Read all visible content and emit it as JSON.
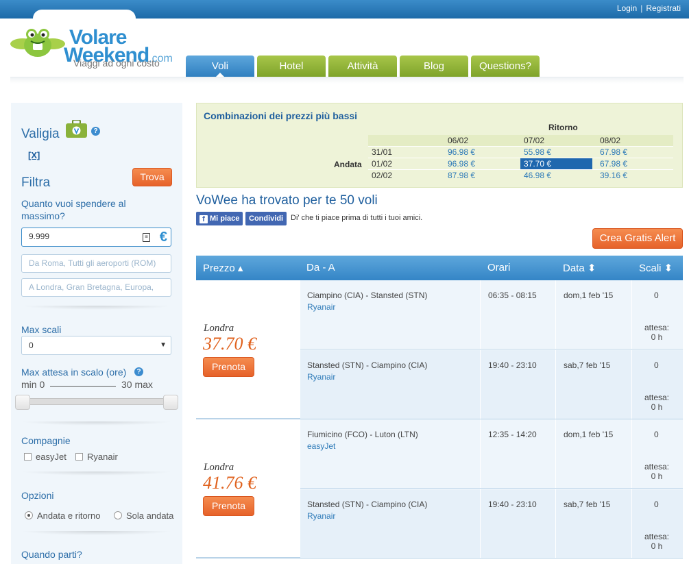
{
  "header": {
    "login": "Login",
    "separator": "|",
    "register": "Registrati"
  },
  "logo": {
    "name_line1": "Volare",
    "name_line2": "Weekend",
    "domain": ".com",
    "tagline": "Viaggi ad ogni costo"
  },
  "nav": {
    "tabs": [
      {
        "label": "Voli",
        "active": true
      },
      {
        "label": "Hotel",
        "active": false
      },
      {
        "label": "Attività",
        "active": false
      },
      {
        "label": "Blog",
        "active": false
      },
      {
        "label": "Questions?",
        "active": false
      }
    ]
  },
  "sidebar": {
    "valigia_title": "Valigia",
    "clear_link": "[X]",
    "filter_title": "Filtra",
    "find_button": "Trova",
    "budget_label": "Quanto vuoi spendere al massimo?",
    "budget_value": "9.999",
    "currency_symbol": "€",
    "from_placeholder": "Da  Roma, Tutti gli aeroporti (ROM)",
    "to_placeholder": "A    Londra, Gran Bretagna, Europa,",
    "max_stops_label": "Max scali",
    "max_stops_value": "0",
    "max_wait_label": "Max attesa in scalo (ore)",
    "min_label": "min 0",
    "max_label": "30 max",
    "airlines_label": "Compagnie",
    "airlines": [
      "easyJet",
      "Ryanair"
    ],
    "options_label": "Opzioni",
    "options": [
      {
        "label": "Andata e ritorno",
        "selected": true
      },
      {
        "label": "Sola andata",
        "selected": false
      }
    ],
    "when_label": "Quando parti?"
  },
  "matrix": {
    "title": "Combinazioni dei prezzi più bassi",
    "return_label": "Ritorno",
    "outbound_label": "Andata",
    "return_dates": [
      "06/02",
      "07/02",
      "08/02"
    ],
    "rows": [
      {
        "date": "31/01",
        "prices": [
          "96.98 €",
          "55.98 €",
          "67.98 €"
        ]
      },
      {
        "date": "01/02",
        "prices": [
          "96.98 €",
          "37.70 €",
          "67.98 €"
        ]
      },
      {
        "date": "02/02",
        "prices": [
          "87.98 €",
          "46.98 €",
          "39.16 €"
        ]
      }
    ],
    "selected": {
      "row": 1,
      "col": 1
    }
  },
  "results": {
    "found_text": "VoWee ha trovato per te 50 voli",
    "fb_like": "Mi piace",
    "fb_share": "Condividi",
    "fb_text": "Di' che ti piace prima di tutti i tuoi amici.",
    "alert_button": "Crea Gratis Alert",
    "columns": {
      "price": "Prezzo ▴",
      "route": "Da - A",
      "times": "Orari",
      "date": "Data ⬍",
      "stops": "Scali ⬍"
    },
    "wait_label": "attesa:",
    "book_label": "Prenota",
    "flights": [
      {
        "city": "Londra",
        "price": "37.70 €",
        "segments": [
          {
            "route": "Ciampino (CIA) - Stansted (STN)",
            "carrier": "Ryanair",
            "times": "06:35 - 08:15",
            "date": "dom,1 feb '15",
            "stops": "0",
            "wait": "0 h"
          },
          {
            "route": "Stansted (STN) - Ciampino (CIA)",
            "carrier": "Ryanair",
            "times": "19:40 - 23:10",
            "date": "sab,7 feb '15",
            "stops": "0",
            "wait": "0 h"
          }
        ]
      },
      {
        "city": "Londra",
        "price": "41.76 €",
        "segments": [
          {
            "route": "Fiumicino (FCO) - Luton (LTN)",
            "carrier": "easyJet",
            "times": "12:35 - 14:20",
            "date": "dom,1 feb '15",
            "stops": "0",
            "wait": "0 h"
          },
          {
            "route": "Stansted (STN) - Ciampino (CIA)",
            "carrier": "Ryanair",
            "times": "19:40 - 23:10",
            "date": "sab,7 feb '15",
            "stops": "0",
            "wait": "0 h"
          }
        ]
      }
    ]
  }
}
